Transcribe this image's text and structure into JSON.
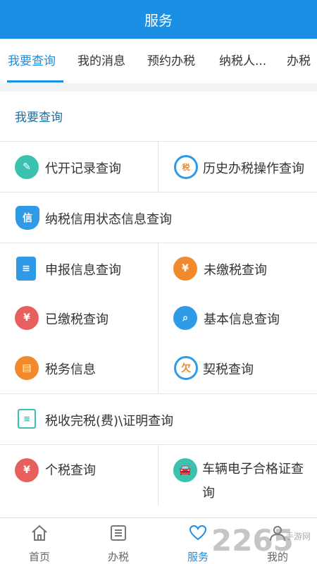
{
  "header": {
    "title": "服务"
  },
  "tabs": [
    {
      "label": "我要查询",
      "active": true
    },
    {
      "label": "我的消息"
    },
    {
      "label": "预约办税"
    },
    {
      "label": "纳税人..."
    },
    {
      "label": "办税"
    }
  ],
  "section": {
    "title": "我要查询"
  },
  "items": {
    "daikai": "代开记录查询",
    "history": "历史办税操作查询",
    "credit": "纳税信用状态信息查询",
    "declare": "申报信息查询",
    "unpaid": "未缴税查询",
    "paid": "已缴税查询",
    "basic": "基本信息查询",
    "taxinfo": "税务信息",
    "deed": "契税查询",
    "cert": "税收完税(费)\\证明查询",
    "personal": "个税查询",
    "vehicle": "车辆电子合格证查询"
  },
  "icons": {
    "daikai_glyph": "✎",
    "history_glyph": "税",
    "credit_glyph": "信",
    "unpaid_glyph": "¥",
    "paid_glyph": "¥",
    "deed_glyph": "欠",
    "personal_glyph": "¥"
  },
  "nav": [
    {
      "label": "首页"
    },
    {
      "label": "办税"
    },
    {
      "label": "服务",
      "active": true
    },
    {
      "label": "我的"
    }
  ],
  "watermark": {
    "main": "2265",
    "sub": "手游网"
  },
  "colors": {
    "primary": "#1b8fe3",
    "teal": "#3cc1b0",
    "orange": "#f08a2c",
    "red": "#e8605e",
    "blue": "#2f9be6"
  }
}
